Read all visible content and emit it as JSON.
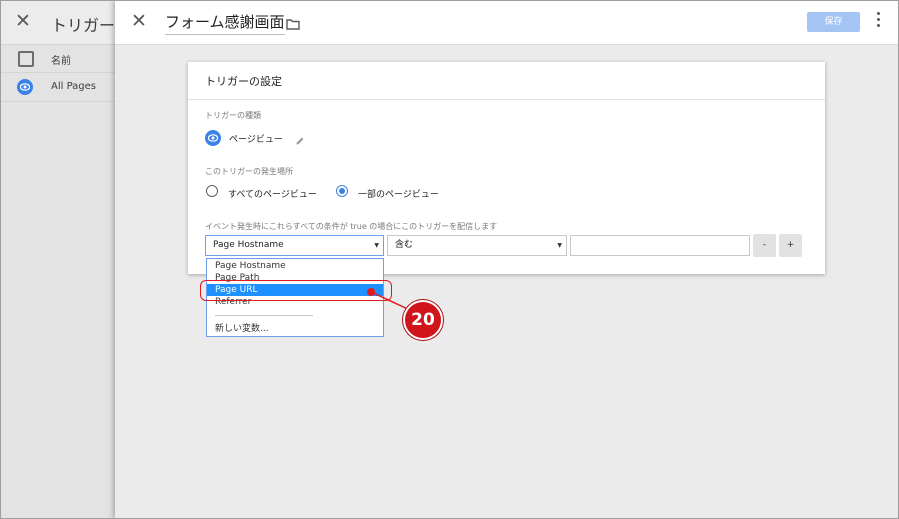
{
  "background_panel": {
    "title": "トリガーの",
    "column_name": "名前",
    "row_label": "All Pages"
  },
  "header": {
    "title": "フォーム感謝画面",
    "save_label": "保存"
  },
  "card": {
    "title": "トリガーの設定",
    "type_label": "トリガーの種類",
    "type_name": "ページビュー",
    "occurrence_label": "このトリガーの発生場所",
    "radio_all": "すべてのページビュー",
    "radio_some": "一部のページビュー",
    "condition_label": "イベント発生時にこれらすべての条件が true の場合にこのトリガーを配信します",
    "variable_value": "Page Hostname",
    "operator_value": "含む",
    "value_input": "",
    "minus_label": "-",
    "plus_label": "+"
  },
  "dropdown": {
    "items": [
      "Page Hostname",
      "Page Path",
      "Page URL",
      "Referrer"
    ],
    "selected": "Page URL",
    "new_variable": "新しい変数..."
  },
  "annotation": {
    "step_number": "20",
    "color": "#d0141c"
  },
  "colors": {
    "accent_blue": "#3b82e6",
    "save_button": "#a4c4f3",
    "selection": "#1e90ff"
  }
}
